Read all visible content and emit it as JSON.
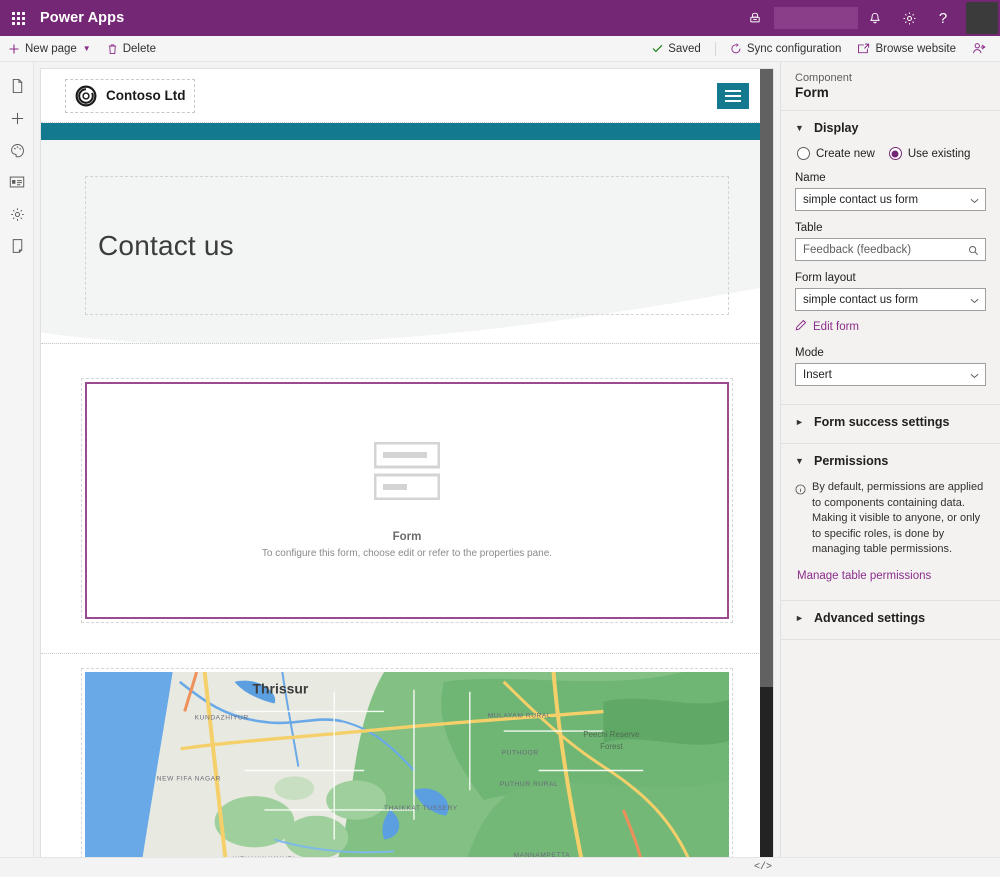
{
  "suite": {
    "waffle": "app-launcher-icon",
    "title": "Power Apps",
    "env_icon": "environment-icon",
    "notifications_icon": "bell-icon",
    "settings_icon": "gear-icon",
    "help_icon": "help-icon",
    "avatar": "user-avatar",
    "brand_color": "#742774"
  },
  "command_bar": {
    "new_page": "New page",
    "delete": "Delete",
    "saved": "Saved",
    "sync_configuration": "Sync configuration",
    "browse_website": "Browse website",
    "invite_icon": "invite-user-icon"
  },
  "left_rail": {
    "items": [
      {
        "name": "pages",
        "icon": "page-icon"
      },
      {
        "name": "add",
        "icon": "plus-icon"
      },
      {
        "name": "styling",
        "icon": "palette-icon"
      },
      {
        "name": "data",
        "icon": "data-card-icon"
      },
      {
        "name": "settings",
        "icon": "gear-icon"
      },
      {
        "name": "preview-device",
        "icon": "mobile-device-icon"
      }
    ]
  },
  "canvas": {
    "site_header": {
      "logo_alt": "Contoso logo",
      "brand_name": "Contoso Ltd",
      "menu_icon": "hamburger-menu-icon",
      "nav_color": "#12798f"
    },
    "hero": {
      "title": "Contact us",
      "background": "#f3f4f4"
    },
    "form_component": {
      "placeholder_icon": "form-placeholder-icon",
      "title": "Form",
      "subtitle": "To configure this form, choose edit or refer to the properties pane.",
      "selected": true,
      "selection_color": "#9a4a91"
    },
    "map_component": {
      "labels": [
        "Thrissur",
        "KUNDAZHIYUR",
        "NEW FIFA NAGAR",
        "MULAYAM RURAL",
        "PUTHOOR",
        "PUTHUR RURAL",
        "THAIKKAT TUSSERY",
        "MANNAMPETTA",
        "KIZHAKKUMMURI",
        "Peechi Reserve Forest"
      ]
    }
  },
  "properties": {
    "kicker": "Component",
    "component_name": "Form",
    "display": {
      "section_title": "Display",
      "chevron": "chevron-down-icon",
      "source_options": [
        {
          "label": "Create new",
          "selected": false
        },
        {
          "label": "Use existing",
          "selected": true
        }
      ],
      "name_label": "Name",
      "name_value": "simple contact us form",
      "table_label": "Table",
      "table_value": "Feedback (feedback)",
      "form_layout_label": "Form layout",
      "form_layout_value": "simple contact us form",
      "edit_form_link": "Edit form",
      "edit_icon": "pencil-icon",
      "mode_label": "Mode",
      "mode_value": "Insert"
    },
    "form_success": {
      "section_title": "Form success settings",
      "chevron": "chevron-right-icon"
    },
    "permissions": {
      "section_title": "Permissions",
      "chevron": "chevron-down-icon",
      "info_icon": "info-icon",
      "info_text": "By default, permissions are applied to components containing data. Making it visible to anyone, or only to specific roles, is done by managing table permissions.",
      "manage_link": "Manage table permissions"
    },
    "advanced": {
      "section_title": "Advanced settings",
      "chevron": "chevron-right-icon"
    }
  },
  "status_bar": {
    "code_editor_label": "</>"
  }
}
